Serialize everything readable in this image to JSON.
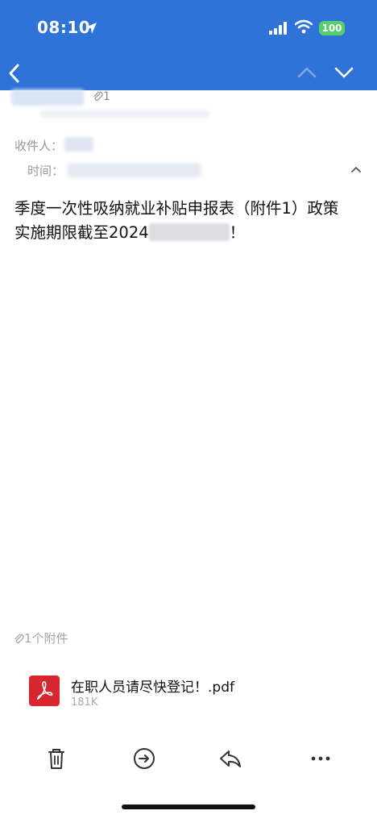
{
  "status_bar": {
    "time": "08:10",
    "battery": "100"
  },
  "header": {
    "attachment_count": "1",
    "recipient_label": "收件人：",
    "time_label": "时间："
  },
  "body": {
    "line1": "季度一次性吸纳就业补贴申报表（附件1）政策",
    "line2_prefix": "实施期限截至2024",
    "line2_suffix": "！"
  },
  "attachments": {
    "header": "1个附件",
    "items": [
      {
        "name": "在职人员请尽快登记！.pdf",
        "size": "181K"
      }
    ]
  },
  "colors": {
    "nav_blue": "#2f73d9",
    "battery_green": "#53d16a",
    "pdf_red": "#d7262f"
  },
  "icons": {
    "back": "chevron-left-icon",
    "prev": "chevron-up-icon",
    "next": "chevron-down-icon",
    "trash": "trash-icon",
    "forward": "forward-icon",
    "reply": "reply-icon",
    "more": "more-icon"
  }
}
